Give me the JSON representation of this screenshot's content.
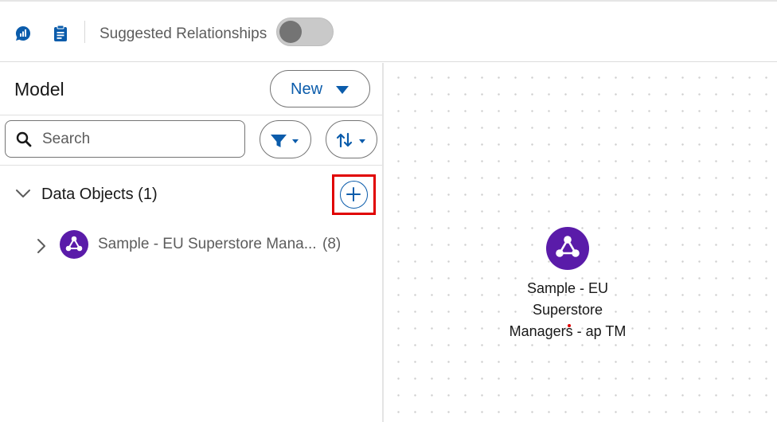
{
  "toolbar": {
    "suggested_relationships_label": "Suggested Relationships",
    "suggested_relationships_on": false,
    "icons": [
      "chart-bubble-icon",
      "clipboard-icon"
    ]
  },
  "sidebar": {
    "title": "Model",
    "new_button_label": "New",
    "search_placeholder": "Search",
    "section": {
      "label": "Data Objects (1)",
      "items": [
        {
          "label": "Sample - EU Superstore Mana...",
          "count": "(8)"
        }
      ]
    }
  },
  "canvas": {
    "node_lines": [
      "Sample - EU",
      "Superstore",
      "Managers - ap TM"
    ]
  },
  "colors": {
    "accent": "#0b5cab",
    "node_purple": "#5a1ba9",
    "highlight": "#e00000"
  }
}
